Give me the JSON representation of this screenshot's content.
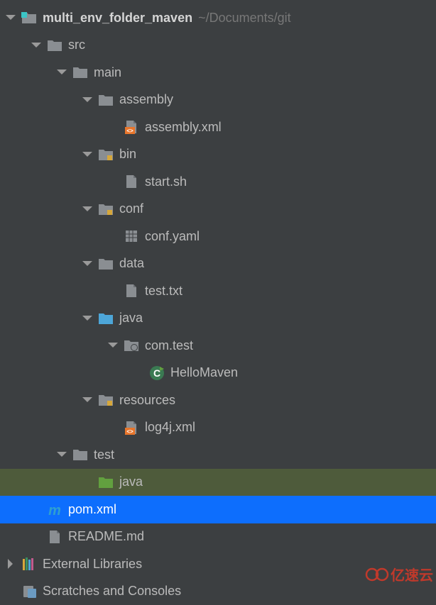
{
  "project": {
    "name": "multi_env_folder_maven",
    "path": "~/Documents/git"
  },
  "tree": {
    "src": "src",
    "main": "main",
    "assembly": "assembly",
    "assembly_xml": "assembly.xml",
    "bin": "bin",
    "start_sh": "start.sh",
    "conf": "conf",
    "conf_yaml": "conf.yaml",
    "data": "data",
    "test_txt": "test.txt",
    "java": "java",
    "com_test": "com.test",
    "hello_maven": "HelloMaven",
    "resources": "resources",
    "log4j_xml": "log4j.xml",
    "test": "test",
    "test_java": "java",
    "pom_xml": "pom.xml",
    "readme": "README.md",
    "external_libraries": "External Libraries",
    "scratches": "Scratches and Consoles"
  },
  "watermark": "亿速云",
  "colors": {
    "bg": "#3c3f41",
    "selected": "#0d6efd",
    "highlighted": "#4e5b3b",
    "folder_gray": "#8a8e92",
    "folder_blue": "#4da6d8",
    "folder_green": "#62a03f",
    "text": "#bbbbbb",
    "muted": "#777777"
  }
}
